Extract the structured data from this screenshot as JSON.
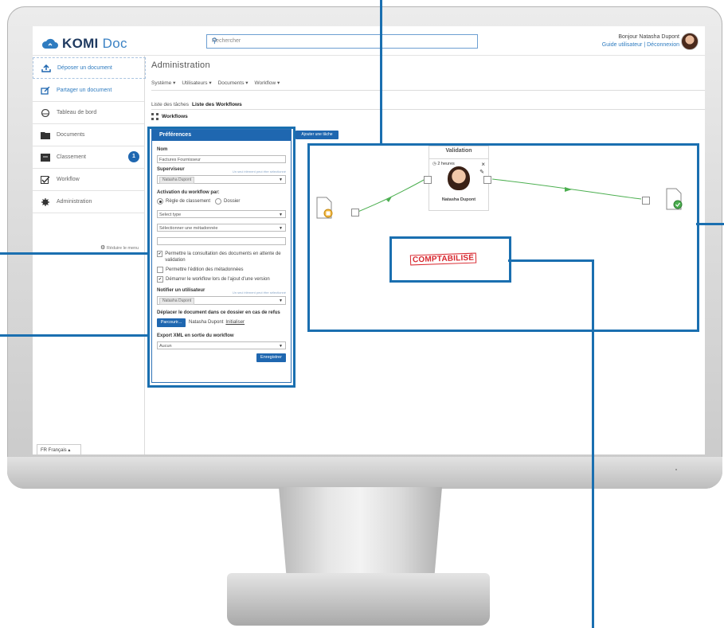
{
  "app": {
    "logo_main": "KOMI",
    "logo_sub": "Doc"
  },
  "header": {
    "search_placeholder": "Rechercher",
    "greeting": "Bonjour Natasha Dupont",
    "guide_link": "Guide utilisateur",
    "separator": "|",
    "logout_link": "Déconnexion"
  },
  "sidebar": {
    "items": [
      {
        "label": "Déposer un document",
        "icon": "upload-icon"
      },
      {
        "label": "Partager un document",
        "icon": "share-icon"
      },
      {
        "label": "Tableau de bord",
        "icon": "dashboard-icon"
      },
      {
        "label": "Documents",
        "icon": "folder-icon"
      },
      {
        "label": "Classement",
        "icon": "archive-icon",
        "badge": "1"
      },
      {
        "label": "Workflow",
        "icon": "checklist-icon"
      },
      {
        "label": "Administration",
        "icon": "gear-icon"
      }
    ],
    "reduce_label": "Réduire le menu",
    "language": "FR  Français ▴"
  },
  "main": {
    "title": "Administration",
    "menu": [
      "Système ▾",
      "Utilisateurs ▾",
      "Documents ▾",
      "Workflow ▾"
    ],
    "tabs": [
      {
        "label": "Liste des tâches",
        "active": false
      },
      {
        "label": "Liste des Workflows",
        "active": true
      }
    ],
    "workflows_heading": "Workflows"
  },
  "prefs": {
    "header": "Préférences",
    "name_label": "Nom",
    "name_value": "Factures Fournisseur",
    "supervisor_label": "Superviseur",
    "supervisor_hint": "Un seul élément peut être sélectionné",
    "supervisor_value": "Natasha Dupont",
    "activation_label": "Activation du workflow par:",
    "radio_rule": "Règle de classement",
    "radio_folder": "Dossier",
    "select_type": "Select type",
    "select_meta": "Sélectionner une métadonnée",
    "opt1": "Permettre la consultation des documents en attente de validation",
    "opt2": "Permettre l'édition des métadonnées",
    "opt3": "Démarrer le workflow lors de l'ajout d'une version",
    "notify_label": "Notifier un utilisateur",
    "notify_hint": "Un seul élément peut être sélectionné",
    "notify_value": "Natasha Dupont",
    "move_label": "Déplacer le document dans ce dossier en cas de refus",
    "browse_button": "Parcourir...",
    "move_user": "Natasha Dupont",
    "reset_link": "Initialiser",
    "export_label": "Export XML en sortie du workflow",
    "export_value": "Aucun",
    "save_button": "Enregistrer"
  },
  "workflow": {
    "add_task": "Ajouter une tâche",
    "node_title": "Validation",
    "node_time": "2 heures",
    "node_user": "Natasha Dupont",
    "stamp": "COMPTABILISÉ"
  },
  "colors": {
    "accent": "#1f67b0",
    "callout": "#1a6fb0",
    "arrow": "#4caf50",
    "stamp": "#d8282f"
  }
}
